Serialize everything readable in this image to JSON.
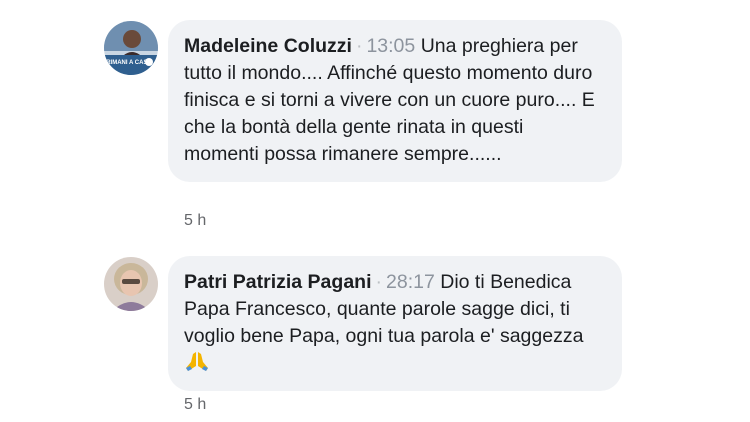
{
  "comments": [
    {
      "author": "Madeleine Coluzzi",
      "separator": "·",
      "timestamp": "13:05",
      "text": "Una preghiera per tutto il mondo.... Affinché questo momento duro finisca e si torni a vivere con un cuore puro.... E che la bontà della gente rinata in questi momenti possa rimanere sempre......",
      "age": "5 h",
      "avatar_caption": "RIMANI A CASA"
    },
    {
      "author": "Patri Patrizia Pagani",
      "separator": "·",
      "timestamp": "28:17",
      "text": "Dio ti Benedica Papa Francesco, quante parole sagge dici, ti voglio bene Papa, ogni tua parola e' saggezza",
      "emoji": "praying-hands-icon",
      "age": "5 h"
    }
  ],
  "colors": {
    "bubble": "#f0f2f5",
    "timestamp": "#8d949e",
    "meta": "#65676b"
  }
}
